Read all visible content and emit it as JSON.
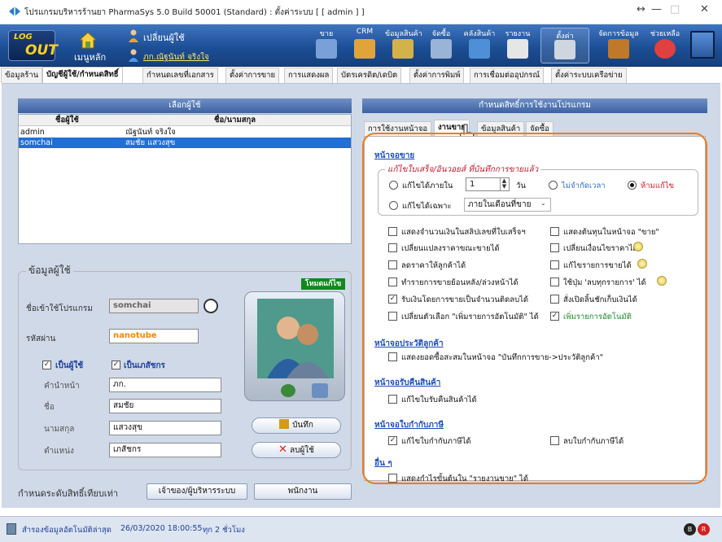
{
  "window": {
    "title": "โปรแกรมบริหารร้านยา PharmaSys 5.0 Build 50001 (Standard) : ตั้งค่าระบบ  [ [ admin ] ]",
    "controls": [
      "↔",
      "—",
      "□",
      "✕"
    ]
  },
  "toolbar": {
    "logout_top": "LOG",
    "logout_bottom": "OUT",
    "main_menu": "เมนูหลัก",
    "change_user": "เปลี่ยนผู้ใช้",
    "current_user": "ภก.ณัฐนันท์ จริงใจ",
    "modules": [
      {
        "label": "ขาย",
        "color": "#7aa0d8"
      },
      {
        "label": "CRM",
        "color": "#e0a43a"
      },
      {
        "label": "ข้อมูลสินค้า",
        "color": "#d4b24a"
      },
      {
        "label": "จัดซื้อ",
        "color": "#9ab4d8"
      },
      {
        "label": "คลังสินค้า",
        "color": "#4f8fd6"
      },
      {
        "label": "รายงาน",
        "color": "#e6e6e6"
      },
      {
        "label": "ตั้งค่า",
        "color": "#cfd6e0"
      },
      {
        "label": "จัดการข้อมูล",
        "color": "#c0792a"
      },
      {
        "label": "ช่วยเหลือ",
        "color": "#e04040"
      }
    ]
  },
  "tabs": [
    "ข้อมูลร้าน",
    "บัญชีผู้ใช้/กำหนดสิทธิ์",
    "กำหนดเลขที่เอกสาร",
    "ตั้งค่าการขาย",
    "การแสดงผล",
    "บัตรเครดิต/เดบิต",
    "ตั้งค่าการพิมพ์",
    "การเชื่อมต่ออุปกรณ์",
    "ตั้งค่าระบบเครือข่าย"
  ],
  "user_select": {
    "title": "เลือกผู้ใช้",
    "columns": [
      "ชื่อผู้ใช้",
      "ชื่อ/นามสกุล"
    ],
    "rows": [
      {
        "user": "admin",
        "name": "ณัฐนันท์ จริงใจ"
      },
      {
        "user": "somchai",
        "name": "สมชัย แสวงสุข"
      }
    ]
  },
  "user_info": {
    "legend": "ข้อมูลผู้ใช้",
    "mode_badge": "โหมดแก้ไข",
    "login_label": "ชื่อเข้าใช้โปรแกรม",
    "login_value": "somchai",
    "password_label": "รหัสผ่าน",
    "password_value": "nanotube",
    "is_user_label": "เป็นผู้ใช้",
    "is_pharmacist_label": "เป็นเภสัชกร",
    "prefix_label": "คำนำหน้า",
    "prefix_value": "ภก.",
    "firstname_label": "ชื่อ",
    "firstname_value": "สมชัย",
    "lastname_label": "นามสกุล",
    "lastname_value": "แสวงสุข",
    "position_label": "ตำแหน่ง",
    "position_value": "เภสัชกร",
    "save_label": "บันทึก",
    "delete_label": "ลบผู้ใช้",
    "level_label": "กำหนดระดับสิทธิ์เทียบเท่า",
    "owner_btn": "เจ้าของ/ผู้บริหารระบบ",
    "staff_btn": "พนักงาน"
  },
  "perm": {
    "title": "กำหนดสิทธิ์การใช้งานโปรแกรม",
    "subtabs": [
      "การใช้งานหน้าจอ",
      "งานขาย",
      "ข้อมูลสินค้า",
      "จัดซื้อ"
    ],
    "sale_section": "หน้าจอขาย",
    "edit_group": "แก้ไขใบเสร็จ/อินวอยส์ ที่บันทึกการขายแล้ว",
    "edit_within_label": "แก้ไขได้ภายใน",
    "edit_within_value": "1",
    "days_label": "วัน",
    "no_limit_label": "ไม่จำกัดเวลา",
    "no_edit_label": "ห้ามแก้ไข",
    "edit_only_label": "แก้ไขได้เฉพาะ",
    "edit_only_value": "ภายในเดือนที่ขาย",
    "checks_left": [
      {
        "label": "แสดงจำนวนเงินในสลิปเลขที่ใบเสร็จฯ",
        "checked": false
      },
      {
        "label": "เปลี่ยนแปลงราคาขณะขายได้",
        "checked": false
      },
      {
        "label": "ลดราคาให้ลูกค้าได้",
        "checked": false
      },
      {
        "label": "ทำรายการขายย้อนหลัง/ล่วงหน้าได้",
        "checked": false
      },
      {
        "label": "รับเงินโดยการขายเป็นจำนวนติดลบได้",
        "checked": true
      },
      {
        "label": "เปลี่ยนตัวเลือก \"เพิ่มรายการอัตโนมัติ\" ได้",
        "checked": false
      }
    ],
    "checks_right": [
      {
        "label": "แสดงต้นทุนในหน้าจอ \"ขาย\"",
        "checked": false,
        "info": false
      },
      {
        "label": "เปลี่ยนเงื่อนไขราคาได้",
        "checked": false,
        "info": true
      },
      {
        "label": "แก้ไขรายการขายได้",
        "checked": false,
        "info": true
      },
      {
        "label": "ใช้ปุ่ม 'ลบทุกรายการ' ได้",
        "checked": false,
        "info": true
      },
      {
        "label": "สั่งเปิดลิ้นชักเก็บเงินได้",
        "checked": false,
        "info": false
      },
      {
        "label": "เพิ่มรายการอัตโนมัติ",
        "checked": true,
        "info": false
      }
    ],
    "history_section": "หน้าจอประวัติลูกค้า",
    "history_check": "แสดงยอดซื้อสะสมในหน้าจอ \"บันทึกการขาย->ประวัติลูกค้า\"",
    "return_section": "หน้าจอรับคืนสินค้า",
    "return_check": "แก้ไขใบรับคืนสินค้าได้",
    "tax_section": "หน้าจอใบกำกับภาษี",
    "tax_edit": "แก้ไขใบกำกับภาษีได้",
    "tax_delete": "ลบใบกำกับภาษีได้",
    "other_section": "อื่น ๆ",
    "other_check": "แสดงกำไรขั้นต้นใน \"รายงานขาย\" ได้"
  },
  "status": {
    "backup_label": "สำรองข้อมูลอัตโนมัติล่าสุด",
    "backup_time": "26/03/2020 18:00:55",
    "interval": "ทุก 2 ชั่วโมง"
  }
}
